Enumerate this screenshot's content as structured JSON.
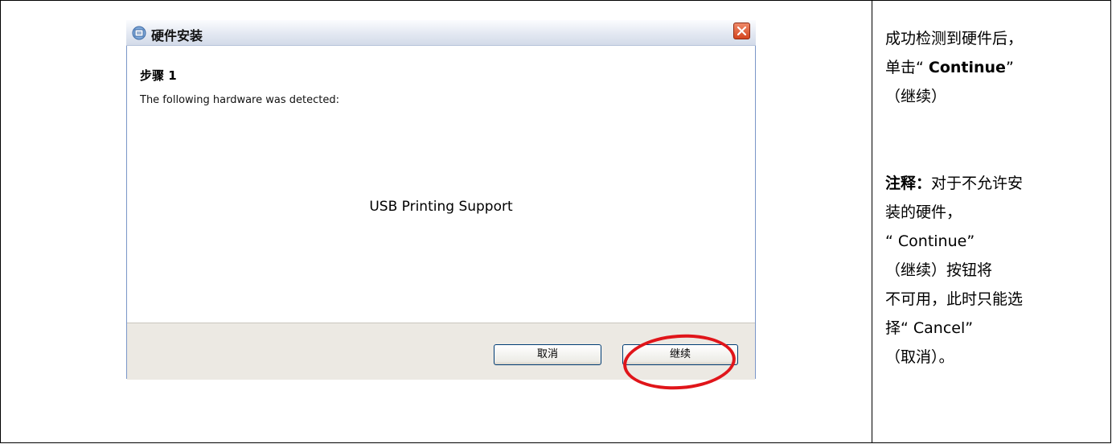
{
  "dialog": {
    "title": "硬件安装",
    "step_title": "步骤 1",
    "detected_label": "The following hardware was detected:",
    "device_name": "USB Printing Support",
    "cancel_label": "取消",
    "continue_label": "继续"
  },
  "notes": {
    "line1": "成功检测到硬件后，",
    "line2_prefix": "单击“ ",
    "line2_bold": "Continue",
    "line2_suffix": "”",
    "line3": "（继续）",
    "note_label": "注释：",
    "note_line1_rest": "对于不允许安",
    "note_line2": "装的硬件，",
    "note_line3": "“ Continue”",
    "note_line4": "（继续）按钮将",
    "note_line5": "不可用，此时只能选",
    "note_line6": "择“ Cancel”",
    "note_line7": "（取消）。"
  },
  "colors": {
    "highlight": "#e0151a",
    "close_button": "#d4441e"
  },
  "icons": [
    "hardware-icon",
    "close-icon"
  ]
}
